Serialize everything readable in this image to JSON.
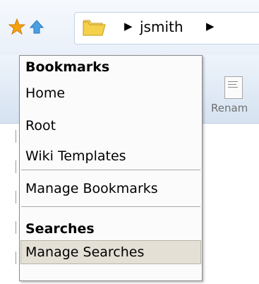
{
  "path": {
    "segments": [
      "jsmith"
    ]
  },
  "ribbon": {
    "rename_label": "Renam"
  },
  "menu": {
    "bookmarks_heading": "Bookmarks",
    "bookmarks": [
      "Home",
      "Root",
      "Wiki Templates"
    ],
    "manage_bookmarks": "Manage Bookmarks",
    "searches_heading": "Searches",
    "manage_searches": "Manage Searches"
  },
  "icons": [
    "star-icon",
    "up-arrow-icon",
    "folder-icon",
    "chevron-right-icon",
    "document-icon"
  ],
  "colors": {
    "accent_blue": "#dfe9f5",
    "hover_bg": "#e4e0d6"
  }
}
